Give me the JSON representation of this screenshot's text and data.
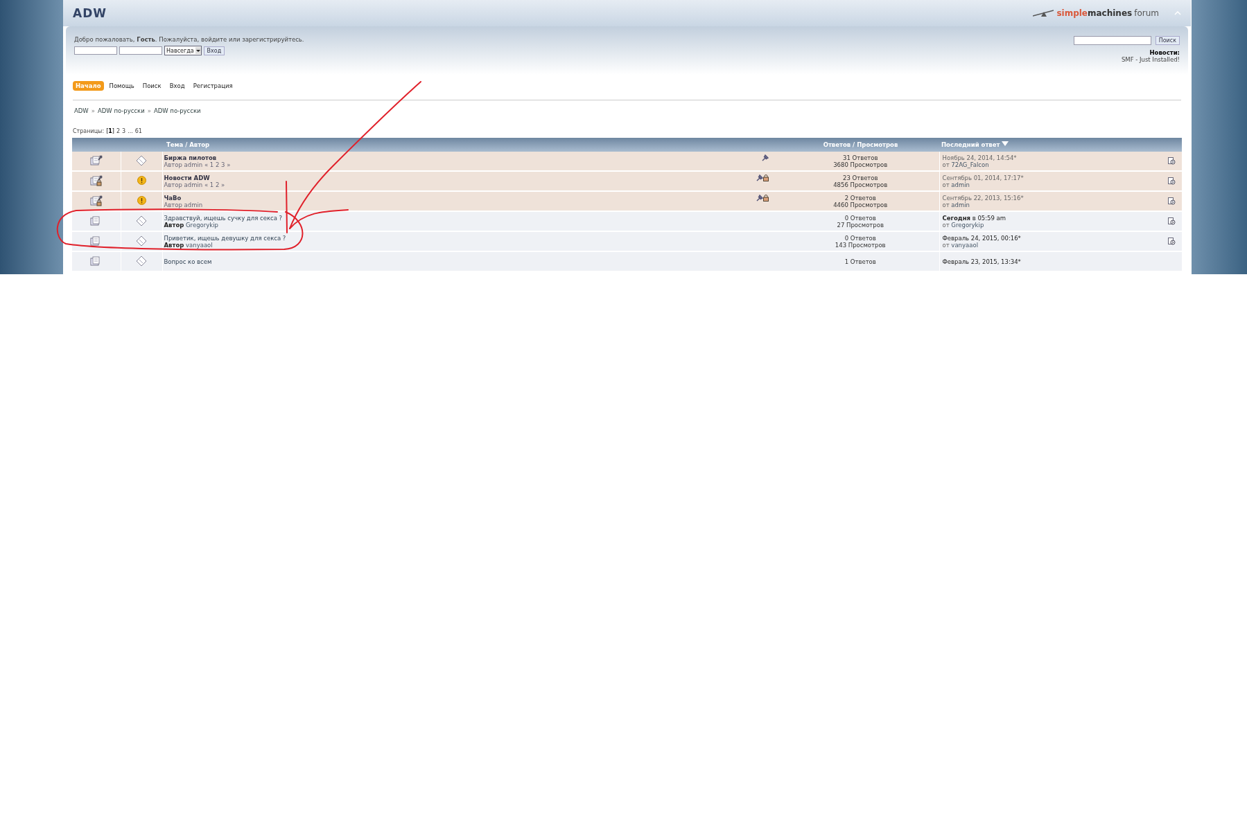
{
  "header": {
    "title": "ADW",
    "logo": {
      "part_1": "simple",
      "part_2": "machines",
      "part_3": "forum"
    }
  },
  "user_panel": {
    "welcome": "Добро пожаловать, **Гость**. Пожалуйста, войдите или зарегистрируйтесь.",
    "duration": "Навсегда",
    "login_button": "Вход"
  },
  "search": {
    "button": "Поиск"
  },
  "news": {
    "label": "Новости:",
    "text": "SMF - Just Installed!"
  },
  "menu": [
    {
      "label": "Начало",
      "selected": true
    },
    {
      "label": "Помощь",
      "selected": false
    },
    {
      "label": "Поиск",
      "selected": false
    },
    {
      "label": "Вход",
      "selected": false
    },
    {
      "label": "Регистрация",
      "selected": false
    }
  ],
  "breadcrumb": [
    {
      "kind": "link",
      "label": "ADW"
    },
    {
      "kind": "separator",
      "label": "»"
    },
    {
      "kind": "link",
      "label": "ADW по-русски"
    },
    {
      "kind": "separator",
      "label": "»"
    },
    {
      "kind": "link",
      "label": "ADW по-русски"
    }
  ],
  "pages": {
    "label": "Страницы:",
    "items": [
      {
        "label": "[**1**]",
        "selected": true
      },
      {
        "label": "2",
        "selected": false
      },
      {
        "label": "3",
        "selected": false
      },
      {
        "label": "...",
        "selected": false
      },
      {
        "label": "61",
        "selected": false
      }
    ]
  },
  "table": {
    "columns": [
      {
        "label": "Тема / Автор",
        "sorted": false
      },
      {
        "label": "Ответов / Просмотров",
        "sorted": false
      },
      {
        "label": "Последний ответ",
        "sorted": true
      }
    ],
    "rows": [
      {
        "sticky": true,
        "locked": false,
        "kind": "standard",
        "title": "Биржа пилотов",
        "author_label": "Автор",
        "author": "admin",
        "topic_pages": "« 1 2 3 »",
        "replies": "31 Ответов",
        "views": "3680 Просмотров",
        "last_date": "Ноябрь 24, 2014, 14:54*",
        "last_by_label": "от",
        "last_by": "72AG_Falcon"
      },
      {
        "sticky": true,
        "locked": true,
        "kind": "exclamation",
        "title": "Новости ADW",
        "author_label": "Автор",
        "author": "admin",
        "topic_pages": "« 1 2 »",
        "replies": "23 Ответов",
        "views": "4856 Просмотров",
        "last_date": "Сентябрь 01, 2014, 17:17*",
        "last_by_label": "от",
        "last_by": "admin"
      },
      {
        "sticky": true,
        "locked": true,
        "kind": "exclamation",
        "title": "ЧаВо",
        "author_label": "Автор",
        "author": "admin",
        "replies": "2 Ответов",
        "views": "4460 Просмотров",
        "last_date": "Сентябрь 22, 2013, 15:16*",
        "last_by_label": "от",
        "last_by": "admin"
      },
      {
        "sticky": false,
        "locked": false,
        "kind": "standard",
        "title": "Здравствуй, ищешь сучку для секса ?",
        "author_label": "Автор",
        "author": "Gregorykip",
        "replies": "0 Ответов",
        "views": "27 Просмотров",
        "last_date": "**Сегодня** в 05:59 am",
        "last_by_label": "от",
        "last_by": "Gregorykip"
      },
      {
        "sticky": false,
        "locked": false,
        "kind": "standard",
        "title": "Приветик, ищешь девушку для секса ?",
        "author_label": "Автор",
        "author": "vanyaaol",
        "replies": "0 Ответов",
        "views": "143 Просмотров",
        "last_date": "Февраль 24, 2015, 00:16*",
        "last_by_label": "от",
        "last_by": "vanyaaol"
      },
      {
        "sticky": false,
        "kind": "standard",
        "title": "Вопрос ко всем",
        "replies": "1 Ответов",
        "last_date": "Февраль 23, 2015, 13:34*"
      }
    ]
  }
}
